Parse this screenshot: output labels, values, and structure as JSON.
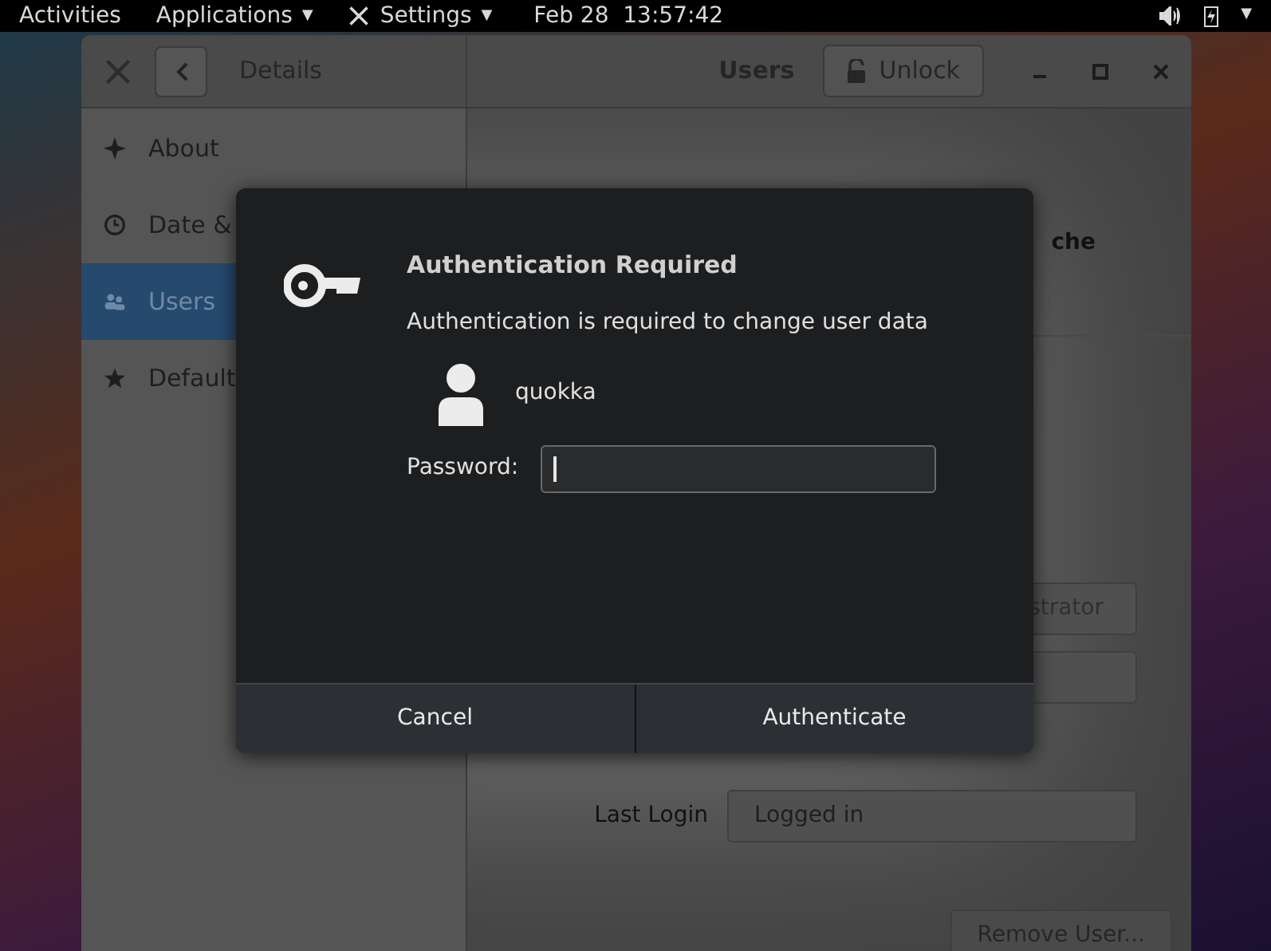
{
  "top_bar": {
    "activities": "Activities",
    "applications": "Applications",
    "settings": "Settings",
    "caret": "▼",
    "date": "Feb 28",
    "time": "13:57:42"
  },
  "window": {
    "title": "Details",
    "panel_title": "Users",
    "unlock": "Unlock"
  },
  "sidebar": {
    "items": [
      {
        "label": "About",
        "kind": "about",
        "selected": false
      },
      {
        "label": "Date &",
        "kind": "clock",
        "selected": false
      },
      {
        "label": "Users",
        "kind": "users",
        "selected": true
      },
      {
        "label": "Default",
        "kind": "star",
        "selected": false
      }
    ]
  },
  "users_panel": {
    "user_name_fragment": "che",
    "account_type_fragment": "strator",
    "last_login_label": "Last Login",
    "last_login_value": "Logged in",
    "remove_button": "Remove User..."
  },
  "dialog": {
    "title": "Authentication Required",
    "message": "Authentication is required to change user data",
    "user": "quokka",
    "password_label": "Password:",
    "buttons": [
      "Cancel",
      "Authenticate"
    ]
  }
}
